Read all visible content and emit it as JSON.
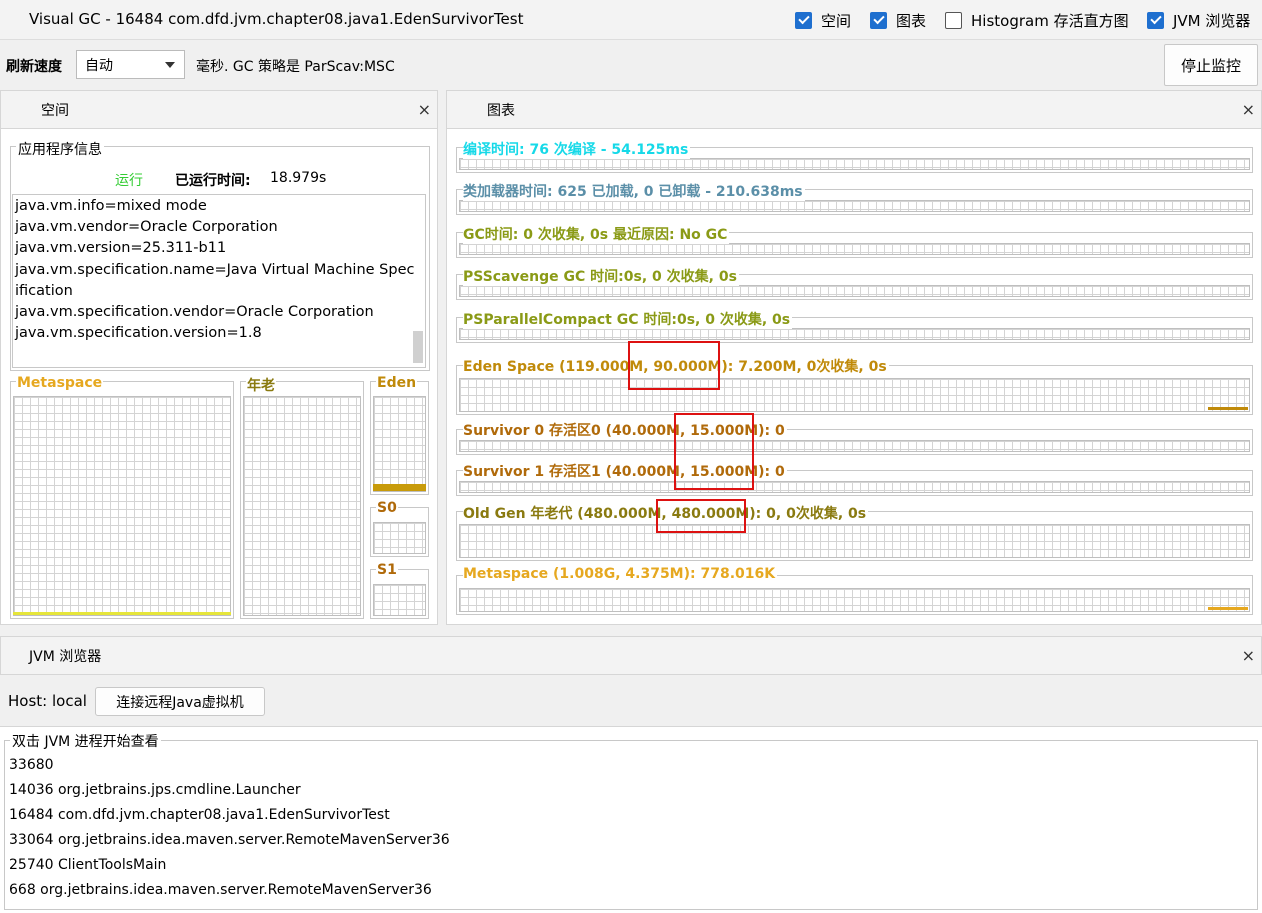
{
  "window": {
    "title": "Visual GC - 16484 com.dfd.jvm.chapter08.java1.EdenSurvivorTest"
  },
  "checkboxes": [
    {
      "label": "空间",
      "checked": true
    },
    {
      "label": "图表",
      "checked": true
    },
    {
      "label": "Histogram 存活直方图",
      "checked": false
    },
    {
      "label": "JVM 浏览器",
      "checked": true
    }
  ],
  "toolbar": {
    "refresh_label": "刷新速度",
    "refresh_value": "自动",
    "policy_text": "毫秒.  GC 策略是 ParScav:MSC",
    "stop_label": "停止监控"
  },
  "space_panel": {
    "title": "空间",
    "app_info_label": "应用程序信息",
    "status": "运行",
    "uptime_label": "已运行时间:",
    "uptime_value": "18.979s",
    "props": [
      "java.vm.info=mixed mode",
      "java.vm.vendor=Oracle Corporation",
      "java.vm.version=25.311-b11",
      "java.vm.specification.name=Java Virtual Machine Spec",
      "ification",
      "java.vm.specification.vendor=Oracle Corporation",
      "java.vm.specification.version=1.8"
    ],
    "regions": {
      "metaspace": "Metaspace",
      "old": "年老",
      "eden": "Eden",
      "s0": "S0",
      "s1": "S1"
    }
  },
  "charts_panel": {
    "title": "图表",
    "rows": [
      {
        "label": "编译时间: 76 次编译 - 54.125ms",
        "color": "#16d9e8"
      },
      {
        "label": "类加载器时间: 625 已加载, 0 已卸载 - 210.638ms",
        "color": "#5b8fa8"
      },
      {
        "label": "GC时间: 0 次收集, 0s 最近原因: No GC",
        "color": "#8a9a16"
      },
      {
        "label": "PSScavenge GC 时间:0s, 0 次收集, 0s",
        "color": "#8a9a16"
      },
      {
        "label": "PSParallelCompact GC 时间:0s, 0 次收集, 0s",
        "color": "#8a9a16"
      },
      {
        "label": "Eden Space (119.000M, 90.000M): 7.200M, 0次收集, 0s",
        "color": "#c08a0a"
      },
      {
        "label": "Survivor 0 存活区0 (40.000M, 15.000M): 0",
        "color": "#b06a0a"
      },
      {
        "label": "Survivor 1 存活区1 (40.000M, 15.000M): 0",
        "color": "#b06a0a"
      },
      {
        "label": "Old Gen 年老代 (480.000M, 480.000M): 0, 0次收集, 0s",
        "color": "#8a7a10"
      },
      {
        "label": "Metaspace (1.008G, 4.375M): 778.016K",
        "color": "#e6a820"
      }
    ]
  },
  "jvm_browser": {
    "title": "JVM 浏览器",
    "host_label": "Host: local",
    "connect_label": "连接远程Java虚拟机",
    "list_label": "双击 JVM 进程开始查看",
    "processes": [
      "33680",
      "14036 org.jetbrains.jps.cmdline.Launcher",
      "16484 com.dfd.jvm.chapter08.java1.EdenSurvivorTest",
      "33064 org.jetbrains.idea.maven.server.RemoteMavenServer36",
      "25740 ClientToolsMain",
      "668 org.jetbrains.idea.maven.server.RemoteMavenServer36"
    ]
  }
}
